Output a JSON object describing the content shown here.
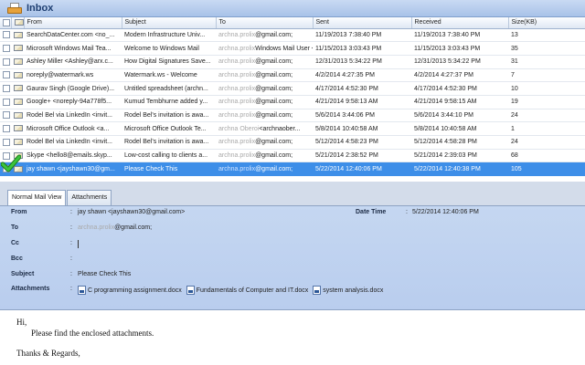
{
  "folder": {
    "title": "Inbox",
    "icon": "inbox-tray-icon"
  },
  "columns": [
    "From",
    "Subject",
    "To",
    "Sent",
    "Received",
    "Size(KB)"
  ],
  "emails": [
    {
      "from": "SearchDataCenter.com <no_...",
      "subject": "Modern Infrastructure Univ...",
      "to_hidden": "archna.prolix",
      "to_domain": "@gmail.com;",
      "sent": "11/19/2013 7:38:40 PM",
      "received": "11/19/2013 7:38:40 PM",
      "size": "13"
    },
    {
      "from": "Microsoft Windows Mail Tea...",
      "subject": "Welcome to Windows Mail",
      "to_hidden": "archna.prolix",
      "to_domain": "Windows Mail User <...",
      "sent": "11/15/2013 3:03:43 PM",
      "received": "11/15/2013 3:03:43 PM",
      "size": "35"
    },
    {
      "from": "Ashley Miller <Ashley@arx.c...",
      "subject": "How Digital Signatures Save...",
      "to_hidden": "archna.prolix",
      "to_domain": "@gmail.com;",
      "sent": "12/31/2013 5:34:22 PM",
      "received": "12/31/2013 5:34:22 PM",
      "size": "31"
    },
    {
      "from": "noreply@watermark.ws",
      "subject": "Watermark.ws - Welcome",
      "to_hidden": "archna.prolix",
      "to_domain": "@gmail.com;",
      "sent": "4/2/2014 4:27:35 PM",
      "received": "4/2/2014 4:27:37 PM",
      "size": "7"
    },
    {
      "from": "Gaurav Singh (Google Drive)...",
      "subject": "Untitled spreadsheet (archn...",
      "to_hidden": "archna.prolix",
      "to_domain": "@gmail.com;",
      "sent": "4/17/2014 4:52:30 PM",
      "received": "4/17/2014 4:52:30 PM",
      "size": "10"
    },
    {
      "from": "Google+ <noreply-94a778f5...",
      "subject": "Kumud Tembhurne added y...",
      "to_hidden": "archna.prolix",
      "to_domain": "@gmail.com;",
      "sent": "4/21/2014 9:58:13 AM",
      "received": "4/21/2014 9:58:15 AM",
      "size": "19"
    },
    {
      "from": "Rodel Bel via LinkedIn <invit...",
      "subject": "Rodel Bel's invitation is awa...",
      "to_hidden": "archna.prolix",
      "to_domain": "@gmail.com;",
      "sent": "5/6/2014 3:44:06 PM",
      "received": "5/6/2014 3:44:10 PM",
      "size": "24"
    },
    {
      "from": "Microsoft Office Outlook <a...",
      "subject": "Microsoft Office Outlook Te...",
      "to_hidden": "archna Oberoi",
      "to_domain": "<archnaober...",
      "sent": "5/8/2014 10:40:58 AM",
      "received": "5/8/2014 10:40:58 AM",
      "size": "1"
    },
    {
      "from": "Rodel Bel via LinkedIn <invit...",
      "subject": "Rodel Bel's invitation is awa...",
      "to_hidden": "archna.prolix",
      "to_domain": "@gmail.com;",
      "sent": "5/12/2014 4:58:23 PM",
      "received": "5/12/2014 4:58:28 PM",
      "size": "24"
    },
    {
      "from": "Skype <hello8@emails.skyp...",
      "subject": "Low-cost calling to clients a...",
      "to_hidden": "archna.prolix",
      "to_domain": "@gmail.com;",
      "sent": "5/21/2014 2:38:52 PM",
      "received": "5/21/2014 2:39:03 PM",
      "size": "68"
    },
    {
      "from": "jay shawn <jayshawn30@gm...",
      "subject": "Please Check This",
      "to_hidden": "archna.prolix",
      "to_domain": "@gmail.com;",
      "sent": "5/22/2014 12:40:06 PM",
      "received": "5/22/2014 12:40:38 PM",
      "size": "105",
      "selected": true
    }
  ],
  "tabs": [
    "Normal Mail View",
    "Attachments"
  ],
  "details": {
    "from_label": "From",
    "from_value": "jay shawn <jayshawn30@gmail.com>",
    "date_label": "Date Time",
    "date_value": "5/22/2014 12:40:06 PM",
    "to_label": "To",
    "to_hidden": "archna.prolix",
    "to_domain": "@gmail.com;",
    "cc_label": "Cc",
    "cc_value": "",
    "bcc_label": "Bcc",
    "bcc_value": "",
    "subject_label": "Subject",
    "subject_value": "Please Check This",
    "attachments_label": "Attachments",
    "attachments": [
      "C programming assignment.docx",
      "Fundamentals of Computer and IT.docx",
      "system analysis.docx"
    ],
    "colon": ":"
  },
  "body": {
    "greeting": "Hi,",
    "line1": "Please find the enclosed attachments.",
    "closing": "Thanks & Regards,"
  },
  "colors": {
    "selected_row": "#3d8ee8",
    "header_bg": "#a8c2e8",
    "details_bg": "#c5d7f1",
    "check": "#2aa82a"
  }
}
